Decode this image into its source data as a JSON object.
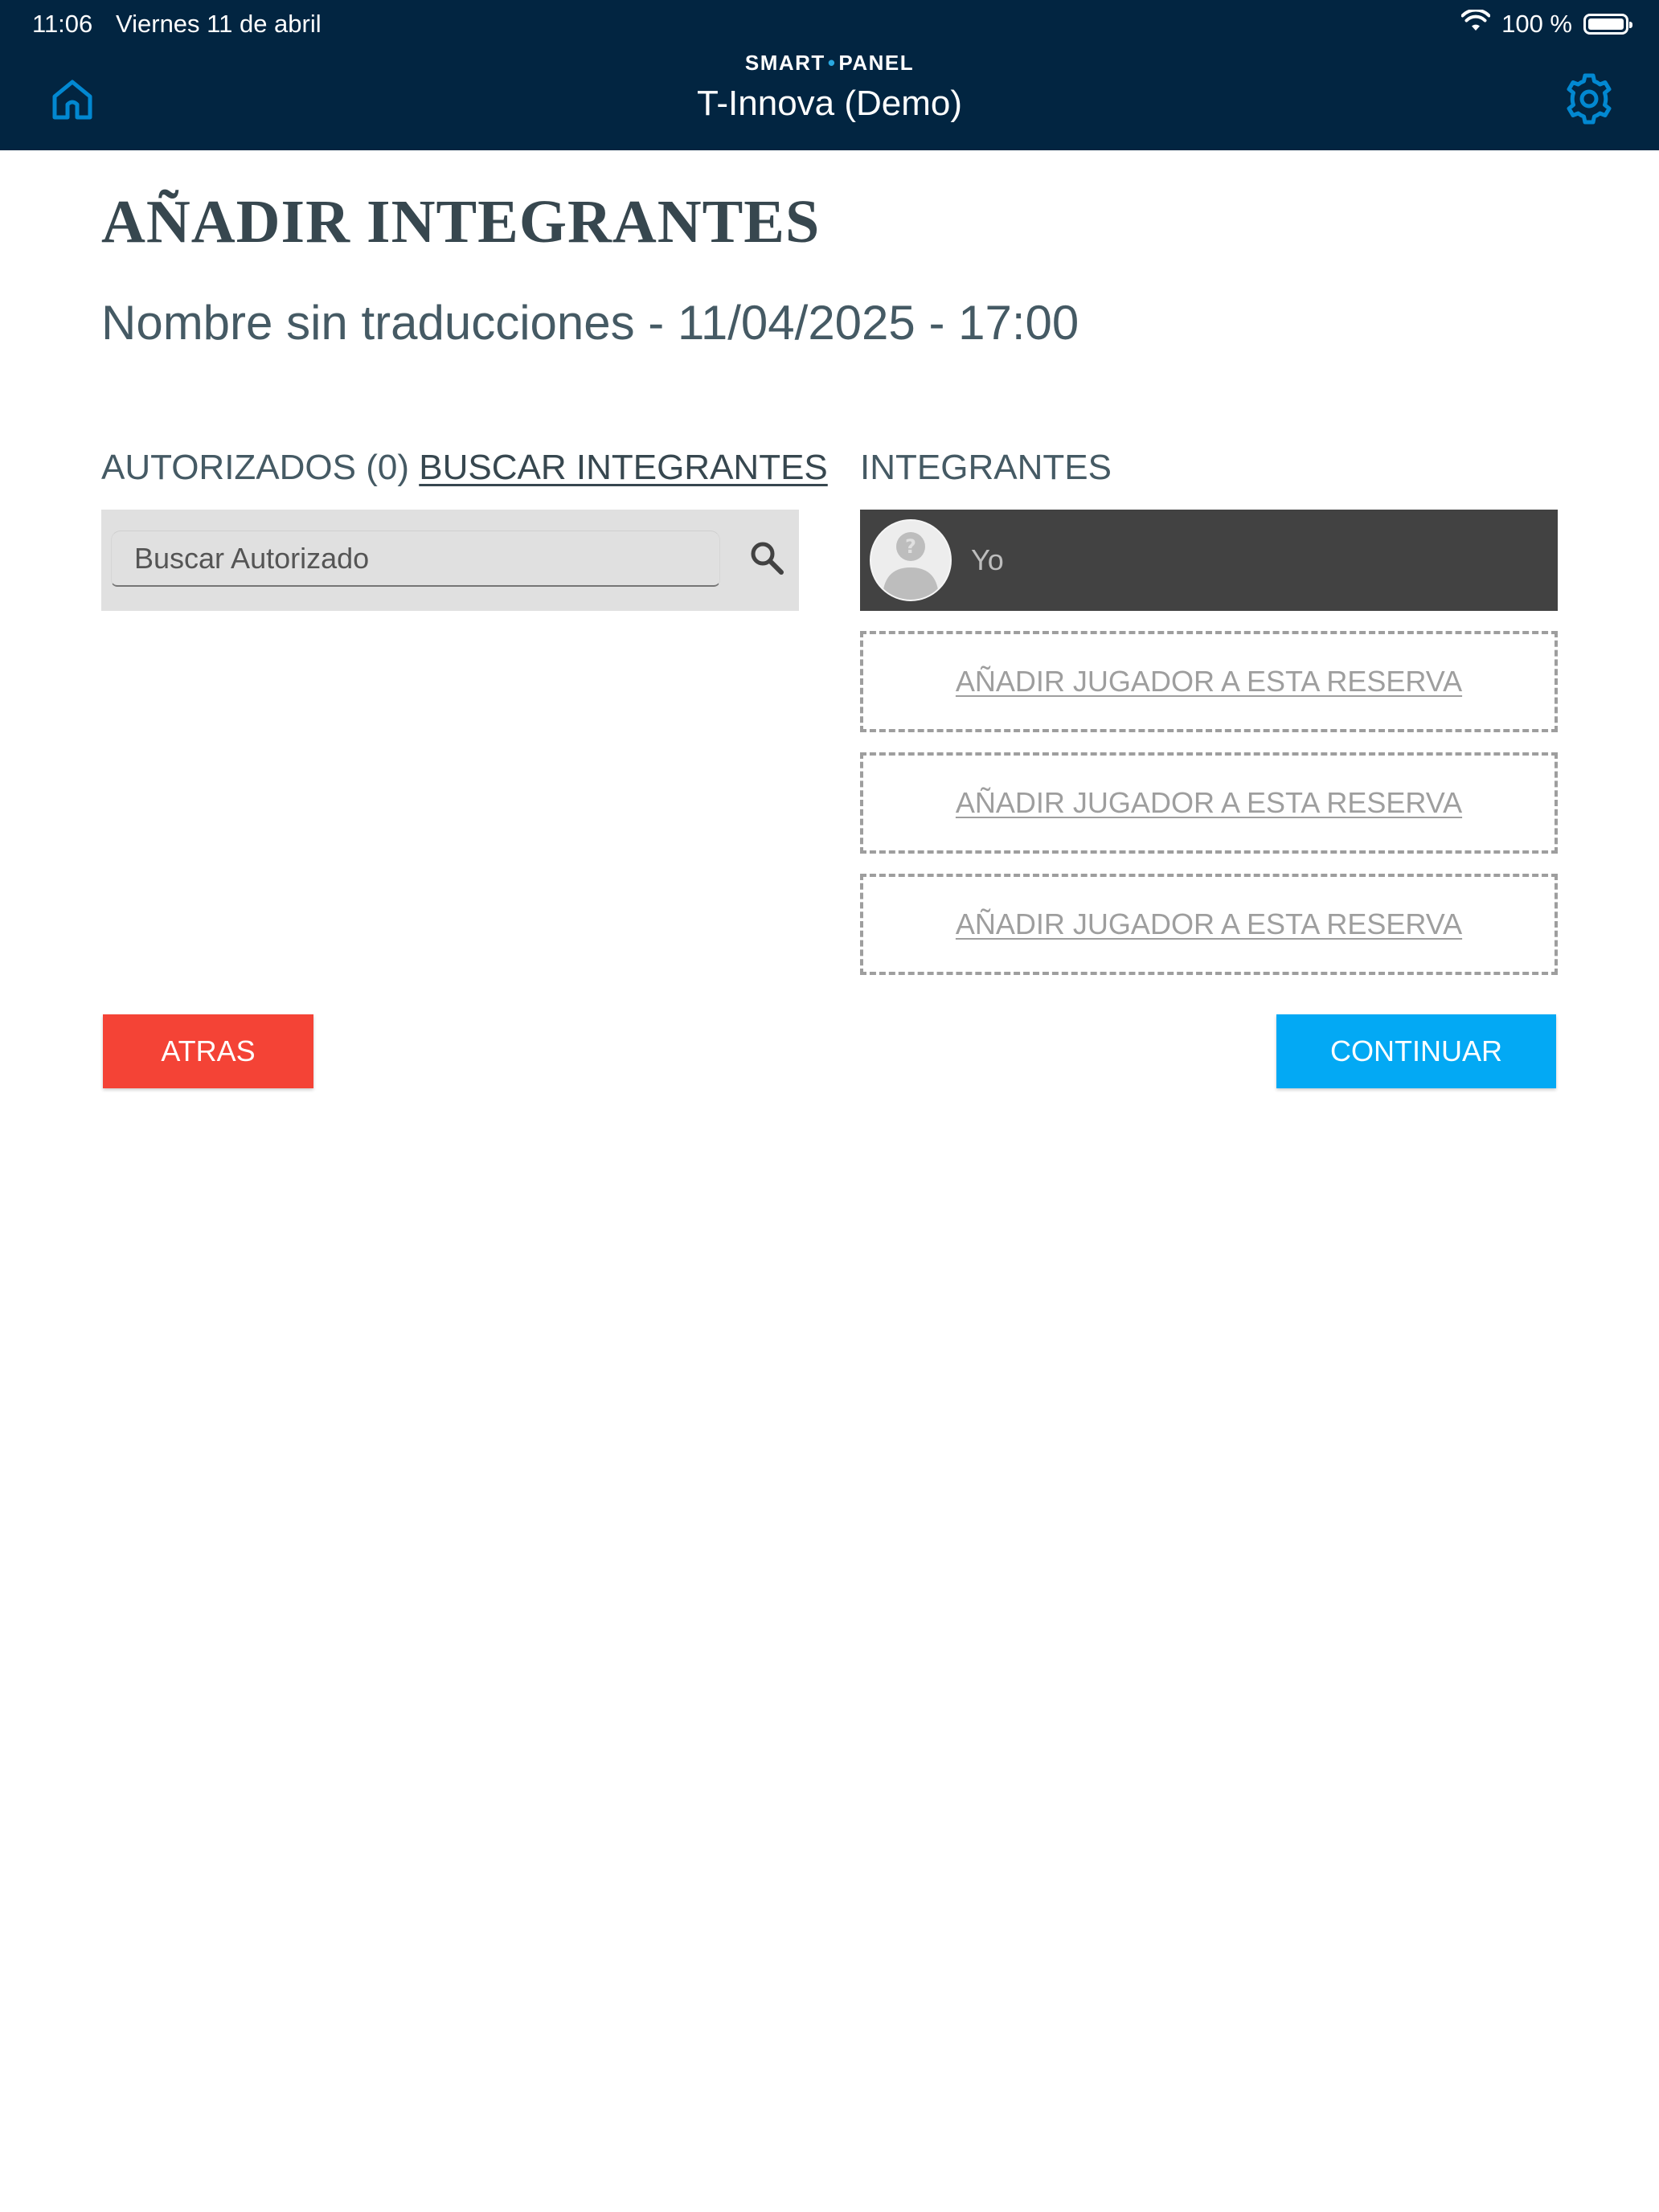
{
  "status_bar": {
    "time": "11:06",
    "date": "Viernes 11 de abril",
    "battery": "100 %",
    "battery_level": 1.0
  },
  "header": {
    "brand_left": "SMART",
    "brand_right": "PANEL",
    "title": "T-Innova (Demo)",
    "home_icon": "home-icon",
    "settings_icon": "gear-icon",
    "icon_color": "#0288d1",
    "background_color": "#022541"
  },
  "page": {
    "title": "AÑADIR INTEGRANTES",
    "subtitle": "Nombre sin traducciones - 11/04/2025 - 17:00"
  },
  "authorized": {
    "heading": "AUTORIZADOS (0)",
    "search_link": "BUSCAR INTEGRANTES",
    "search_placeholder": "Buscar Autorizado",
    "search_value": ""
  },
  "members": {
    "heading": "INTEGRANTES",
    "list": [
      {
        "name": "Yo",
        "avatar_icon": "user-placeholder-icon"
      }
    ],
    "add_slots": [
      {
        "label": "AÑADIR JUGADOR A ESTA RESERVA"
      },
      {
        "label": "AÑADIR JUGADOR A ESTA RESERVA"
      },
      {
        "label": "AÑADIR JUGADOR A ESTA RESERVA"
      }
    ]
  },
  "actions": {
    "back_label": "ATRAS",
    "back_color": "#f44336",
    "continue_label": "CONTINUAR",
    "continue_color": "#03a9f4"
  }
}
